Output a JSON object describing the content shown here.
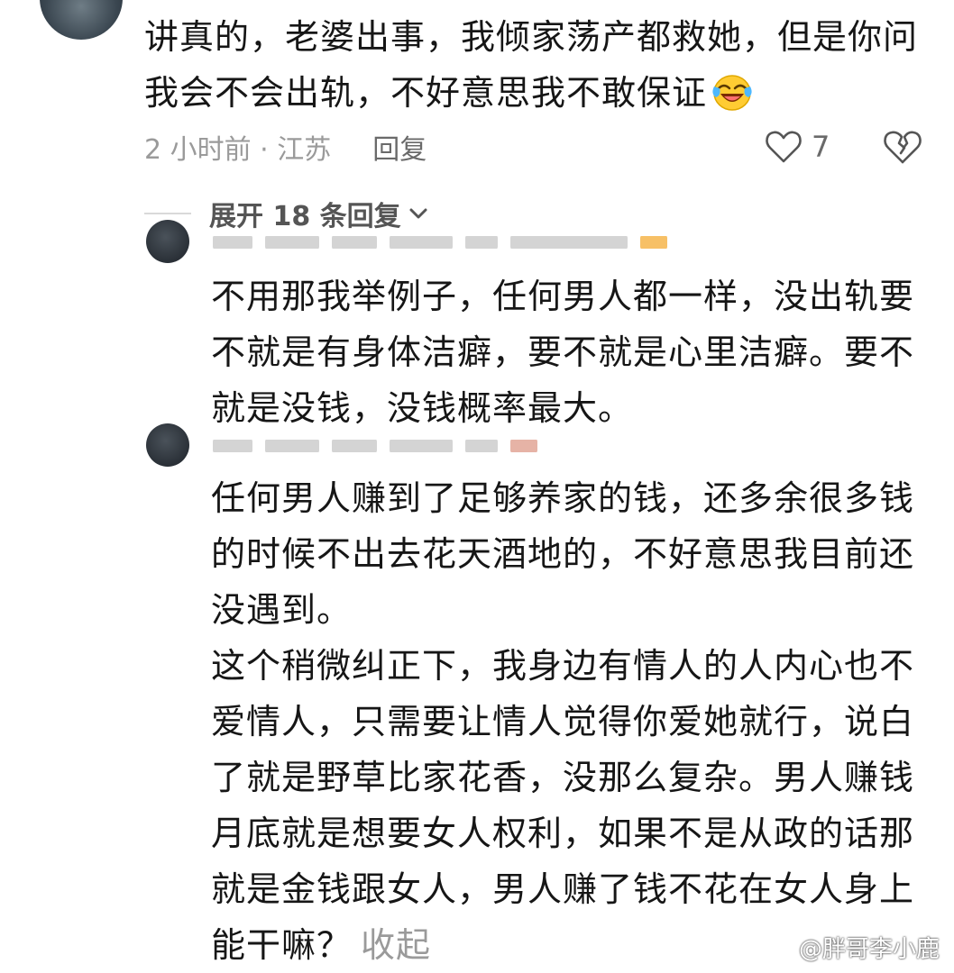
{
  "comment": {
    "text": "讲真的，老婆出事，我倾家荡产都救她，但是你问我会不会出轨，不好意思我不敢保证",
    "emoji": "laughing-crying-emoji",
    "time_location": "2 小时前 · 江苏",
    "reply_label": "回复",
    "like_count": "7",
    "icons": {
      "like": "heart-icon",
      "dislike": "broken-heart-icon"
    }
  },
  "replies_toggle": {
    "label": "展开 18 条回复"
  },
  "replies": [
    {
      "text": "不用那我举例子，任何男人都一样，没出轨要不就是有身体洁癖，要不就是心里洁癖。要不就是没钱，没钱概率最大。"
    },
    {
      "text": "任何男人赚到了足够养家的钱，还多余很多钱的时候不出去花天酒地的，不好意思我目前还没遇到。",
      "text2": "这个稍微纠正下，我身边有情人的人内心也不爱情人，只需要让情人觉得你爱她就行，说白了就是野草比家花香，没那么复杂。男人赚钱月底就是想要女人权利，如果不是从政的话那就是金钱跟女人，男人赚了钱不花在女人身上能干嘛？",
      "collapse_label": "收起"
    }
  ],
  "watermark": {
    "text": "@胖哥李小鹿",
    "icon": "weibo-icon"
  },
  "colors": {
    "text": "#161616",
    "meta": "#9a9a9a",
    "action": "#6a6a6a"
  }
}
